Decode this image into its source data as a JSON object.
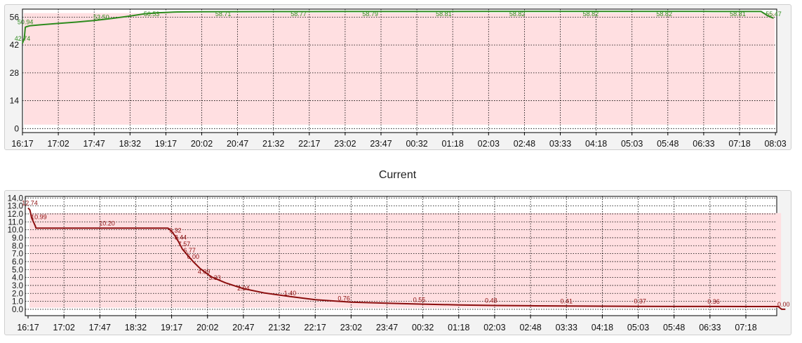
{
  "chart_data": [
    {
      "type": "line",
      "title": "",
      "color": "#2e8b1e",
      "band_color": "#ffdfe1",
      "band_range": [
        2,
        58
      ],
      "ylim": [
        -2,
        60
      ],
      "yticks": [
        "0",
        "14",
        "28",
        "42",
        "56"
      ],
      "ytick_values": [
        0,
        14,
        28,
        42,
        56
      ],
      "xticks": [
        "16:17",
        "17:02",
        "17:47",
        "18:32",
        "19:17",
        "20:02",
        "20:47",
        "21:32",
        "22:17",
        "23:02",
        "23:47",
        "00:32",
        "01:18",
        "02:03",
        "02:48",
        "03:33",
        "04:18",
        "05:03",
        "05:48",
        "06:33",
        "07:18",
        "08:03"
      ],
      "grid": true,
      "series": [
        {
          "x": [
            0,
            0.05,
            0.08,
            0.12,
            0.2,
            0.5,
            1,
            1.5,
            2,
            2.5,
            3,
            3.4,
            3.8,
            4,
            4.2,
            4.4,
            5,
            6,
            7,
            8,
            9,
            10,
            11,
            12,
            13,
            14,
            15,
            16,
            17,
            18,
            19,
            20,
            20.6,
            20.8,
            20.95
          ],
          "values": [
            42.74,
            45.5,
            50.94,
            51.2,
            51.6,
            52.1,
            52.8,
            53.5,
            54.3,
            55.3,
            56.53,
            57.6,
            58.2,
            58.35,
            58.5,
            58.6,
            58.71,
            58.74,
            58.77,
            58.78,
            58.79,
            58.8,
            58.81,
            58.81,
            58.82,
            58.82,
            58.82,
            58.82,
            58.82,
            58.82,
            58.82,
            58.81,
            58.81,
            56.5,
            55.47
          ]
        }
      ],
      "data_labels": [
        {
          "x": 0,
          "y": 42.74,
          "text": "42.74"
        },
        {
          "x": 0.08,
          "y": 50.94,
          "text": "50.94"
        },
        {
          "x": 2.2,
          "y": 53.5,
          "text": "53.50"
        },
        {
          "x": 3.6,
          "y": 56.53,
          "text": "56.53"
        },
        {
          "x": 5.6,
          "y": 58.71,
          "text": "58.71"
        },
        {
          "x": 7.7,
          "y": 58.77,
          "text": "58.77"
        },
        {
          "x": 9.7,
          "y": 58.79,
          "text": "58.79"
        },
        {
          "x": 11.75,
          "y": 58.81,
          "text": "58.81"
        },
        {
          "x": 13.8,
          "y": 58.82,
          "text": "58.82"
        },
        {
          "x": 15.85,
          "y": 58.82,
          "text": "58.82"
        },
        {
          "x": 17.9,
          "y": 58.82,
          "text": "58.82"
        },
        {
          "x": 19.95,
          "y": 58.81,
          "text": "58.81"
        },
        {
          "x": 20.95,
          "y": 55.47,
          "text": "55.47"
        }
      ]
    },
    {
      "type": "line",
      "title": "Current",
      "color": "#8b0f0f",
      "band_color": "#ffdfe1",
      "band_range": [
        0.2,
        12.1
      ],
      "ylim": [
        -0.8,
        14.2
      ],
      "yticks": [
        "0.0",
        "1.0",
        "2.0",
        "3.0",
        "4.0",
        "5.0",
        "6.0",
        "7.0",
        "8.0",
        "9.0",
        "10.0",
        "11.0",
        "12.0",
        "13.0",
        "14.0"
      ],
      "ytick_values": [
        0,
        1,
        2,
        3,
        4,
        5,
        6,
        7,
        8,
        9,
        10,
        11,
        12,
        13,
        14
      ],
      "xticks": [
        "16:17",
        "17:02",
        "17:47",
        "18:32",
        "19:17",
        "20:02",
        "20:47",
        "21:32",
        "22:17",
        "23:02",
        "23:47",
        "00:32",
        "01:18",
        "02:03",
        "02:48",
        "03:33",
        "04:18",
        "05:03",
        "05:48",
        "06:33",
        "07:18"
      ],
      "grid": true,
      "series": [
        {
          "x": [
            0,
            0.05,
            0.1,
            0.15,
            0.2,
            0.22,
            0.3,
            1,
            2,
            3,
            3.9,
            4.0,
            4.1,
            4.2,
            4.3,
            4.45,
            4.6,
            4.8,
            5.1,
            5.5,
            6.0,
            6.6,
            7.3,
            8,
            9,
            10,
            11,
            12,
            13,
            14,
            15,
            16,
            17,
            18,
            19,
            20,
            20.9,
            21.0,
            21.1
          ],
          "values": [
            12.74,
            12.5,
            11.5,
            10.99,
            10.5,
            10.2,
            10.2,
            10.2,
            10.2,
            10.2,
            10.2,
            9.8,
            9.2,
            8.44,
            7.57,
            6.77,
            6.0,
            5.1,
            4.09,
            3.33,
            2.6,
            2.04,
            1.6,
            1.2,
            0.9,
            0.76,
            0.65,
            0.55,
            0.48,
            0.44,
            0.41,
            0.39,
            0.37,
            0.36,
            0.36,
            0.35,
            0.35,
            0.0,
            0.0
          ]
        }
      ],
      "data_labels": [
        {
          "x": 0.05,
          "y": 12.74,
          "text": "12.74"
        },
        {
          "x": 0.3,
          "y": 10.99,
          "text": "10.99"
        },
        {
          "x": 2.2,
          "y": 10.2,
          "text": "10.20"
        },
        {
          "x": 4.1,
          "y": 9.32,
          "text": "9.32"
        },
        {
          "x": 4.25,
          "y": 8.44,
          "text": "8.44"
        },
        {
          "x": 4.35,
          "y": 7.57,
          "text": "7.57"
        },
        {
          "x": 4.5,
          "y": 6.77,
          "text": "6.77"
        },
        {
          "x": 4.6,
          "y": 6.0,
          "text": "6.00"
        },
        {
          "x": 4.9,
          "y": 4.09,
          "text": "4.09"
        },
        {
          "x": 5.2,
          "y": 3.33,
          "text": "3.33"
        },
        {
          "x": 6.0,
          "y": 2.04,
          "text": "2.04"
        },
        {
          "x": 7.3,
          "y": 1.4,
          "text": "1.40"
        },
        {
          "x": 8.8,
          "y": 0.76,
          "text": "0.76"
        },
        {
          "x": 10.9,
          "y": 0.55,
          "text": "0.55"
        },
        {
          "x": 12.9,
          "y": 0.48,
          "text": "0.48"
        },
        {
          "x": 15.0,
          "y": 0.41,
          "text": "0.41"
        },
        {
          "x": 17.05,
          "y": 0.37,
          "text": "0.37"
        },
        {
          "x": 19.1,
          "y": 0.36,
          "text": "0.36"
        },
        {
          "x": 21.05,
          "y": 0.0,
          "text": "0.00"
        }
      ]
    }
  ]
}
